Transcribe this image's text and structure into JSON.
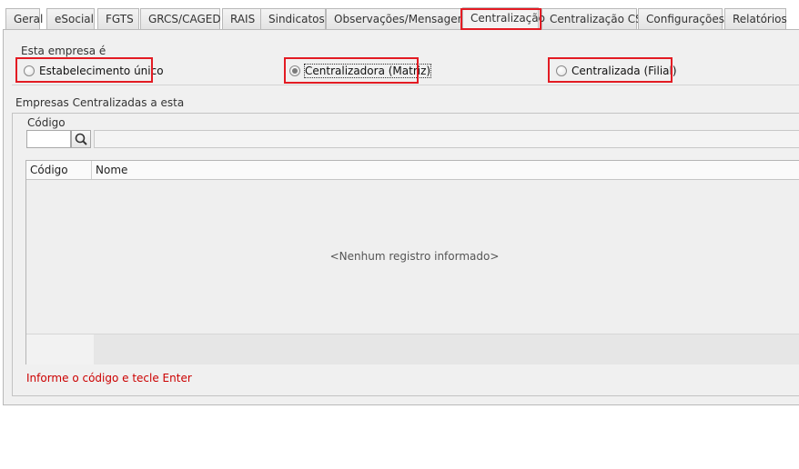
{
  "tabs": [
    {
      "label": "Geral"
    },
    {
      "label": "eSocial"
    },
    {
      "label": "FGTS"
    },
    {
      "label": "GRCS/CAGED"
    },
    {
      "label": "RAIS"
    },
    {
      "label": "Sindicatos"
    },
    {
      "label": "Observações/Mensagens"
    },
    {
      "label": "Centralização",
      "active": true
    },
    {
      "label": "Centralização CS"
    },
    {
      "label": "Configurações"
    },
    {
      "label": "Relatórios"
    }
  ],
  "empresa_tipo": {
    "group_label": "Esta empresa é",
    "options": [
      {
        "label": "Estabelecimento único",
        "selected": false
      },
      {
        "label": "Centralizadora (Matriz)",
        "selected": true
      },
      {
        "label": "Centralizada (Filial)",
        "selected": false
      }
    ]
  },
  "centralizadas": {
    "group_label": "Empresas Centralizadas a esta",
    "codigo_label": "Código",
    "codigo_value": "",
    "nome_value": "",
    "columns": [
      "Código",
      "Nome"
    ],
    "rows": [],
    "empty_message": "<Nenhum registro informado>",
    "hint": "Informe o código e tecle Enter"
  },
  "colors": {
    "highlight": "#e31b23",
    "hint": "#cc0000",
    "panel_bg": "#f0f0f0"
  }
}
